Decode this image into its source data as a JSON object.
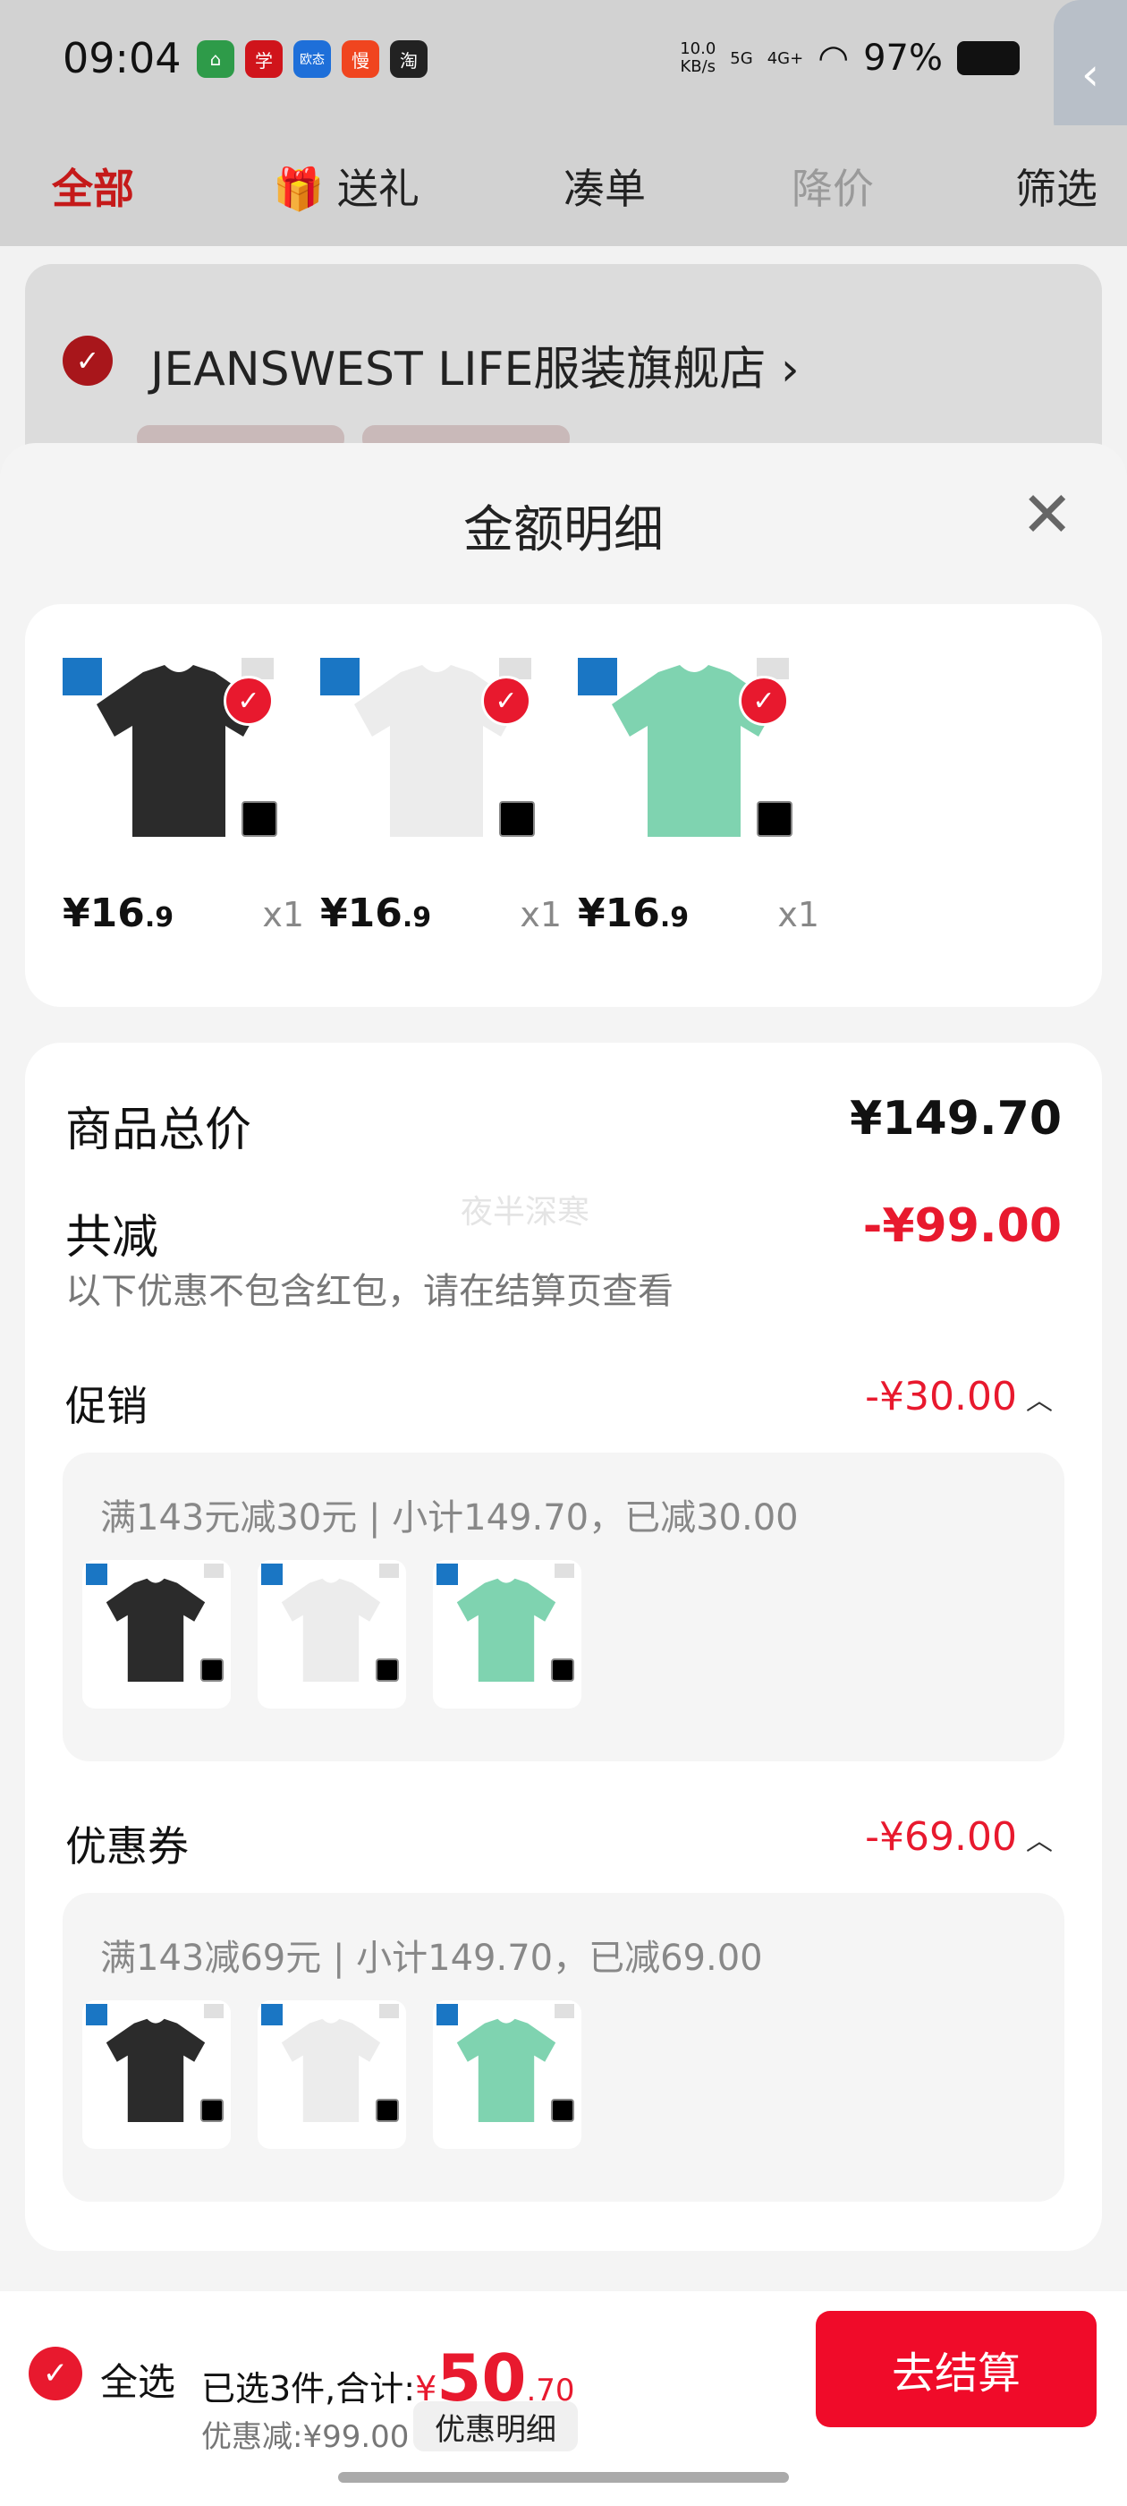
{
  "status_bar": {
    "time": "09:04",
    "app_icons": [
      "⌂",
      "学",
      "欧态",
      "慢",
      "淘"
    ],
    "net_speed_value": "10.0",
    "net_speed_unit": "KB/s",
    "signal_1": "5G",
    "signal_2": "4G+",
    "battery": "97%"
  },
  "tabs": [
    {
      "label": "全部"
    },
    {
      "label": "送礼"
    },
    {
      "label": "凑单"
    },
    {
      "label": "降价"
    },
    {
      "label": "筛选"
    }
  ],
  "store": {
    "name": "JEANSWEST LIFE服装旗舰店 ›"
  },
  "sheet": {
    "title": "金额明细",
    "goods": [
      {
        "price_int": "¥16",
        "price_dec": ".9",
        "qty": "x1",
        "color": "#2b2b2b"
      },
      {
        "price_int": "¥16",
        "price_dec": ".9",
        "qty": "x1",
        "color": "#ececec"
      },
      {
        "price_int": "¥16",
        "price_dec": ".9",
        "qty": "x1",
        "color": "#7fd3b0"
      }
    ],
    "total_label": "商品总价",
    "total_value": "¥149.70",
    "reduce_label": "共减",
    "reduce_value": "-¥99.00",
    "reduce_note": "以下优惠不包含红包，请在结算页查看",
    "watermark": "夜半深寒",
    "promo": {
      "label": "促销",
      "value": "-¥30.00",
      "rule": "满143元减30元 | 小计149.70，已减30.00"
    },
    "coupon": {
      "label": "优惠券",
      "value": "-¥69.00",
      "rule": "满143减69元 | 小计149.70，已减69.00"
    }
  },
  "bottom_bar": {
    "select_all": "全选",
    "selected_summary": "已选3件,合计:",
    "currency": "¥",
    "total_int": "50",
    "total_dec": ".70",
    "discount": "优惠减:¥99.00",
    "detail_button": "优惠明细",
    "checkout_button": "去结算"
  },
  "colors": {
    "accent": "#e8192e",
    "checkout": "#f00b29"
  }
}
